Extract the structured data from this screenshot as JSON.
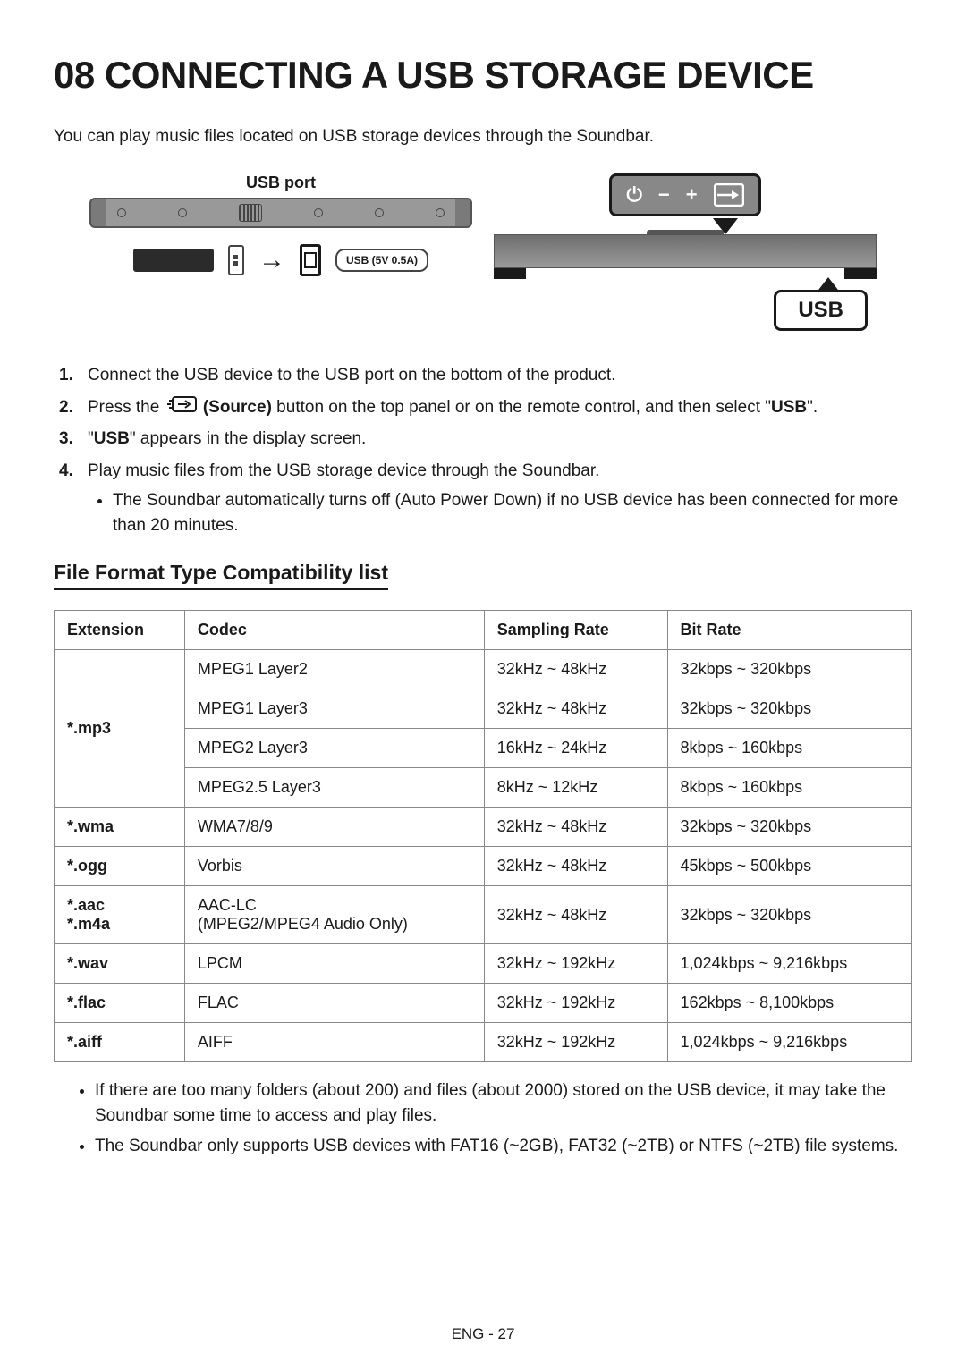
{
  "title": "08 CONNECTING A USB STORAGE DEVICE",
  "intro": "You can play music files located on USB storage devices through the Soundbar.",
  "diagram": {
    "usb_port_label": "USB port",
    "usb_socket_label": "USB (5V 0.5A)",
    "usb_display_text": "USB"
  },
  "steps": [
    {
      "text": "Connect the USB device to the USB port on the bottom of the product."
    },
    {
      "pre": "Press the ",
      "source_word": "(Source)",
      "post": " button on the top panel or on the remote control, and then select \"",
      "bold_end": "USB",
      "post2": "\"."
    },
    {
      "pre": "\"",
      "bold": "USB",
      "post": "\" appears in the display screen."
    },
    {
      "text": "Play music files from the USB storage device through the Soundbar.",
      "bullets": [
        "The Soundbar automatically turns off (Auto Power Down) if no USB device has been connected for more than 20 minutes."
      ]
    }
  ],
  "section_sub": "File Format Type Compatibility list",
  "table": {
    "headers": [
      "Extension",
      "Codec",
      "Sampling Rate",
      "Bit Rate"
    ],
    "rows": [
      {
        "ext": "*.mp3",
        "rowspan": 4,
        "codec": "MPEG1 Layer2",
        "rate": "32kHz ~ 48kHz",
        "bit": "32kbps ~ 320kbps"
      },
      {
        "codec": "MPEG1 Layer3",
        "rate": "32kHz ~ 48kHz",
        "bit": "32kbps ~ 320kbps"
      },
      {
        "codec": "MPEG2 Layer3",
        "rate": "16kHz ~ 24kHz",
        "bit": "8kbps ~ 160kbps"
      },
      {
        "codec": "MPEG2.5 Layer3",
        "rate": "8kHz ~ 12kHz",
        "bit": "8kbps ~ 160kbps"
      },
      {
        "ext": "*.wma",
        "rowspan": 1,
        "codec": "WMA7/8/9",
        "rate": "32kHz ~ 48kHz",
        "bit": "32kbps ~ 320kbps"
      },
      {
        "ext": "*.ogg",
        "rowspan": 1,
        "codec": "Vorbis",
        "rate": "32kHz ~ 48kHz",
        "bit": "45kbps ~ 500kbps"
      },
      {
        "ext": "*.aac\n*.m4a",
        "rowspan": 1,
        "codec": "AAC-LC\n(MPEG2/MPEG4 Audio Only)",
        "rate": "32kHz ~ 48kHz",
        "bit": "32kbps ~ 320kbps"
      },
      {
        "ext": "*.wav",
        "rowspan": 1,
        "codec": "LPCM",
        "rate": "32kHz ~ 192kHz",
        "bit": "1,024kbps ~ 9,216kbps"
      },
      {
        "ext": "*.flac",
        "rowspan": 1,
        "codec": "FLAC",
        "rate": "32kHz ~ 192kHz",
        "bit": "162kbps ~ 8,100kbps"
      },
      {
        "ext": "*.aiff",
        "rowspan": 1,
        "codec": "AIFF",
        "rate": "32kHz ~ 192kHz",
        "bit": "1,024kbps ~ 9,216kbps"
      }
    ]
  },
  "notes": [
    "If there are too many folders (about 200) and files (about 2000) stored on the USB device, it may take the Soundbar some time to access and play files.",
    "The Soundbar only supports USB devices with FAT16 (~2GB), FAT32 (~2TB) or NTFS (~2TB) file systems."
  ],
  "page_num": "ENG - 27"
}
